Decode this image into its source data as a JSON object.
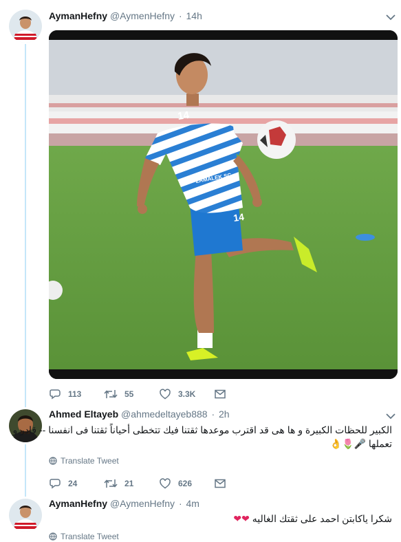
{
  "tweets": [
    {
      "display_name": "AymanHefny",
      "handle": "@AymenHefny",
      "time": "14h",
      "stats": {
        "replies": "113",
        "retweets": "55",
        "likes": "3.3K"
      },
      "media": {
        "jersey_number": "14",
        "sponsor_text": "ZAMALEK SC"
      }
    },
    {
      "display_name": "Ahmed Eltayeb",
      "handle": "@ahmedeltayeb888",
      "time": "2h",
      "text_line1": "الكبير  للحظات الكبيرة   و ها هى قد اقترب  موعدها    ثقتنا فيك تتخطى أحياناً ثقتنا فى انفسنا   -- قادر و",
      "text_line2": "تعملها 🎤🌷👌",
      "translate_label": "Translate Tweet",
      "stats": {
        "replies": "24",
        "retweets": "21",
        "likes": "626"
      }
    },
    {
      "display_name": "AymanHefny",
      "handle": "@AymenHefny",
      "time": "4m",
      "text": "شكرا ياكابتن احمد على ثقتك الغاليه",
      "hearts": "❤❤",
      "translate_label": "Translate Tweet"
    }
  ],
  "separator": "·",
  "icons": [
    "reply-icon",
    "retweet-icon",
    "like-icon",
    "message-icon",
    "globe-icon",
    "chevron-down-icon"
  ],
  "colors": {
    "thread_line": "#c4e6f9",
    "secondary_text": "#657786",
    "heart": "#e0245e"
  }
}
